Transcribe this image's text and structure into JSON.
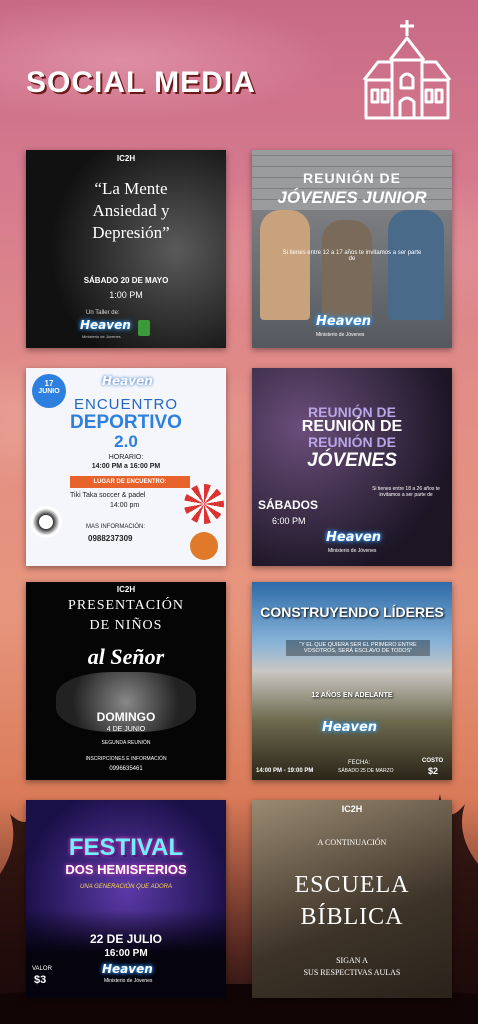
{
  "page": {
    "title": "SOCIAL MEDIA"
  },
  "icons": {
    "church": "church-icon"
  },
  "cards": {
    "c1": {
      "brand": "IC2H",
      "quote": "“La Mente Ansiedad y Depresión”",
      "date": "SÁBADO 20 DE MAYO",
      "time": "1:00 PM",
      "taller": "Un Taller de:",
      "heaven": "Heaven",
      "ministerio": "Ministerio de Jóvenes"
    },
    "c2": {
      "title1": "REUNIÓN DE",
      "title2": "JÓVENES JUNIOR",
      "text": "Si tienes entre 12 a 17 años te invitamos a ser parte de",
      "heaven": "Heaven",
      "ministerio": "Ministerio de Jóvenes"
    },
    "c3": {
      "badge_day": "17",
      "badge_month": "JUNIO",
      "heaven": "Heaven",
      "title1": "ENCUENTRO",
      "title2": "DEPORTIVO",
      "title3": "2.0",
      "horario_label": "HORARIO:",
      "horario": "14:00 PM a 16:00 PM",
      "lugar_label": "LUGAR DE ENCUENTRO:",
      "lugar": "Tiki Taka soccer & padel",
      "lugar_time": "14:00 pm",
      "info_label": "MAS INFORMACIÓN:",
      "phone": "0988237309"
    },
    "c4": {
      "title1": "REUNIÓN DE",
      "title2": "REUNIÓN DE",
      "title3": "REUNIÓN DE",
      "title4": "JÓVENES",
      "day": "SÁBADOS",
      "time": "6:00 PM",
      "text": "Si tienes entre 18 a 26 años te invitamos a ser parte de",
      "heaven": "Heaven",
      "ministerio": "Ministerio de Jóvenes"
    },
    "c5": {
      "brand": "IC2H",
      "title1": "PRESENTACIÓN",
      "title2": "DE NIÑOS",
      "title3": "al Señor",
      "day": "DOMINGO",
      "date": "4 DE JUNIO",
      "reunion": "SEGUNDA REUNIÓN",
      "info": "INSCRIPCIONES E INFORMACIÓN",
      "phone": "0996635461"
    },
    "c6": {
      "title": "CONSTRUYENDO LÍDERES",
      "quote": "“Y EL QUE QUIERA SER EL PRIMERO ENTRE VOSOTROS, SERÁ ESCLAVO DE TODOS”",
      "age": "12 AÑOS EN ADELANTE",
      "heaven": "Heaven",
      "time": "14:00 PM - 19:00 PM",
      "fecha_label": "FECHA:",
      "fecha": "SÁBADO 25 DE MARZO",
      "costo_label": "COSTO",
      "costo": "$2"
    },
    "c7": {
      "title1": "FESTIVAL",
      "title2": "DOS HEMISFERIOS",
      "subtitle": "UNA GENERACIÓN QUE ADORA",
      "date": "22 DE JULIO",
      "time": "16:00 PM",
      "heaven": "Heaven",
      "ministerio": "Ministerio de Jóvenes",
      "valor_label": "VALOR",
      "valor": "$3"
    },
    "c8": {
      "brand": "IC2H",
      "intro": "A CONTINUACIÓN",
      "title1": "ESCUELA",
      "title2": "BÍBLICA",
      "footer1": "SIGAN A",
      "footer2": "SUS RESPECTIVAS AULAS"
    }
  }
}
